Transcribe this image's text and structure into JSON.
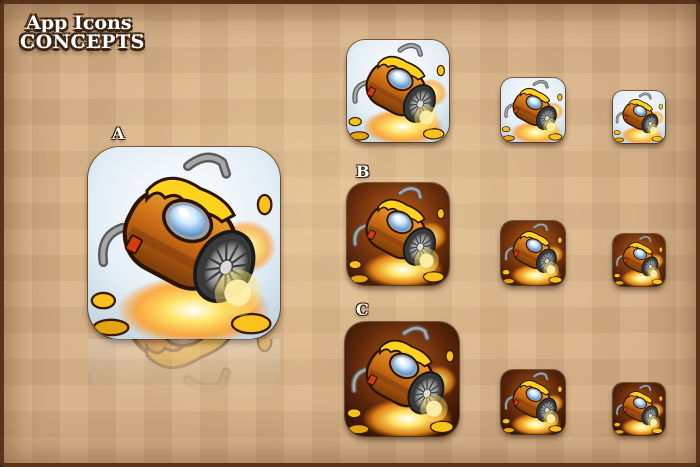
{
  "title": {
    "line1": "App Icons",
    "line2": "CONCEPTS"
  },
  "concepts": [
    {
      "label": "A",
      "variant": "light",
      "background": "#e8f1f6"
    },
    {
      "label": "B",
      "variant": "dark",
      "background": "#7a3a10"
    },
    {
      "label": "C",
      "variant": "dark",
      "background": "#5a2a0c"
    }
  ],
  "icon_subject": "rocket-jet-engine-icon",
  "colors": {
    "wood_background": "#d7b084",
    "frame": "#5a3418",
    "engine_body": "#d8861e",
    "flame_glow": "#ffd23a",
    "dome_glass": "#bfe3ff"
  }
}
